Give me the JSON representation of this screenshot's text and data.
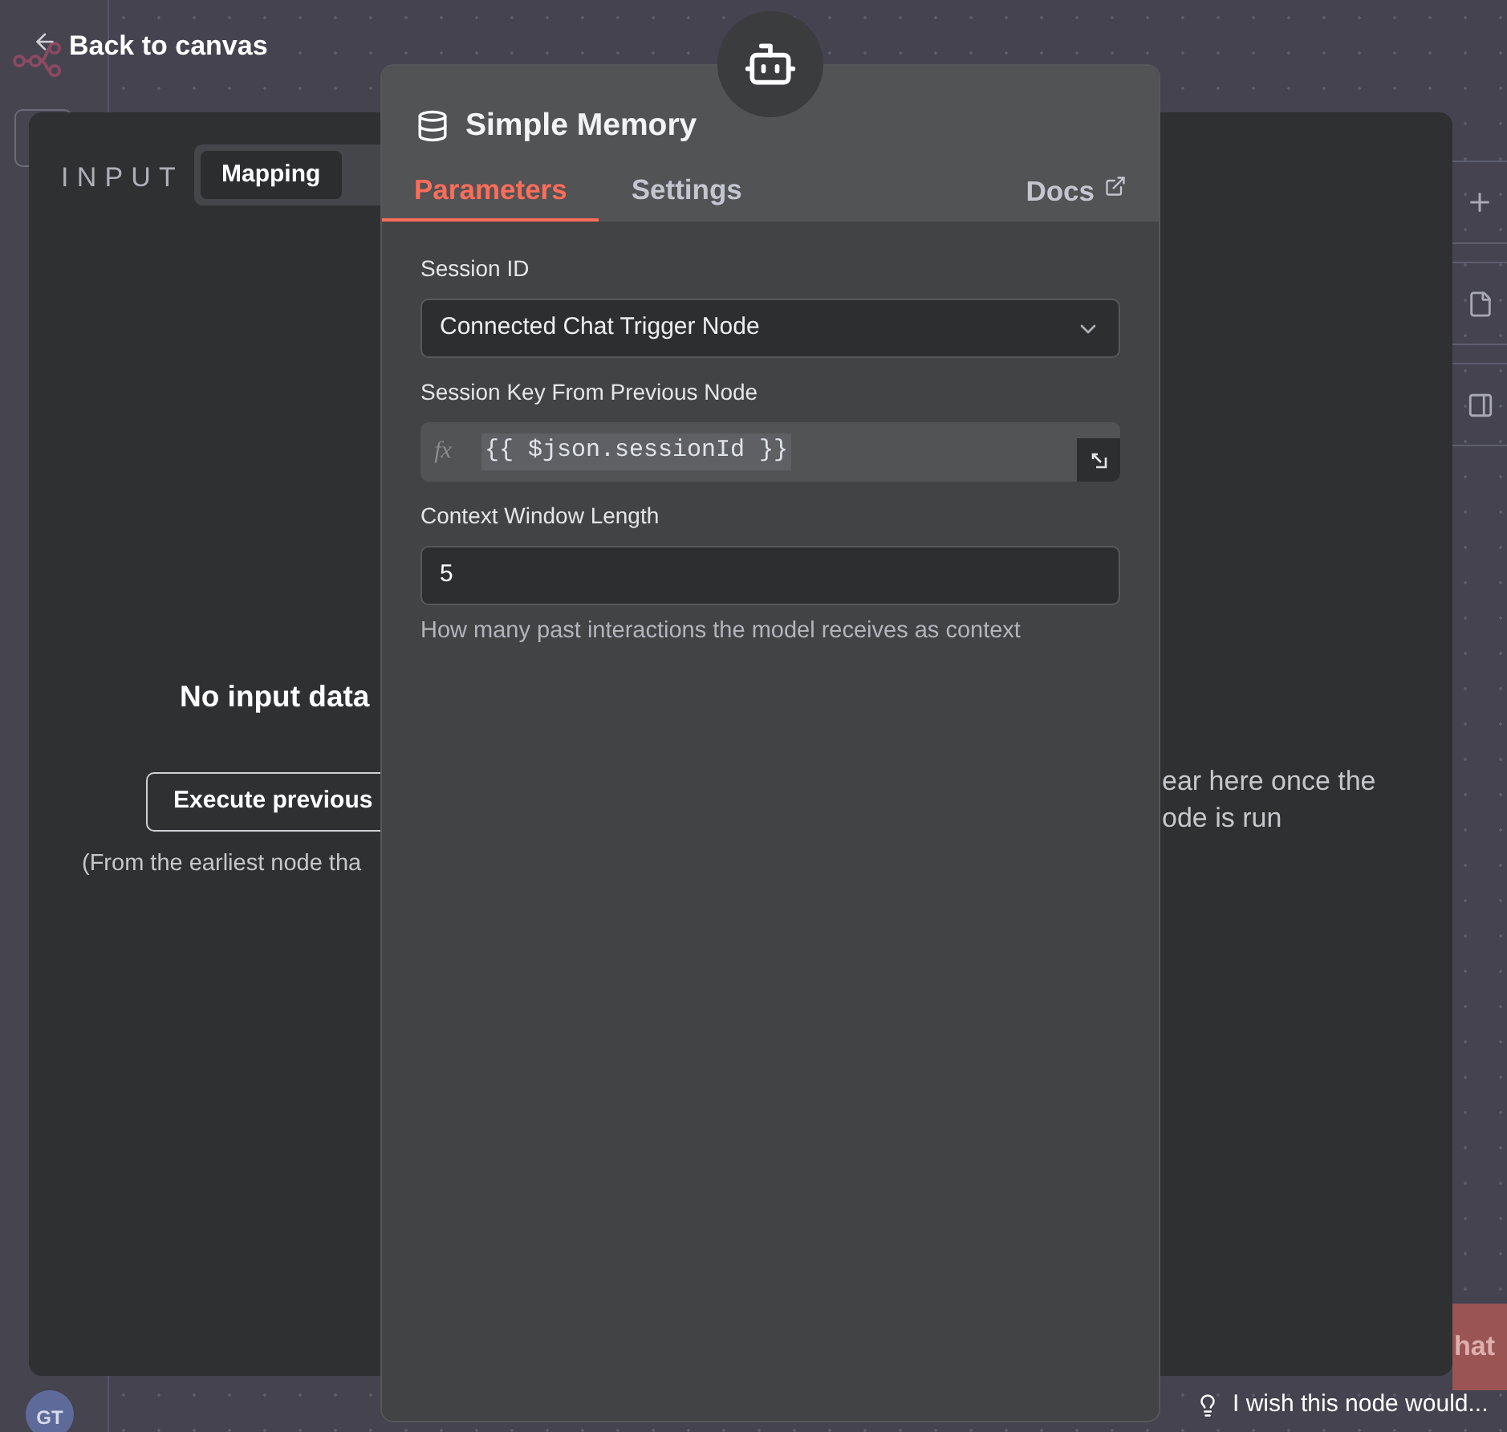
{
  "header": {
    "back_label": "Back to canvas"
  },
  "input_panel": {
    "title": "INPUT",
    "tabs": [
      {
        "label": "Mapping",
        "selected": true
      }
    ],
    "empty_title": "No input data",
    "execute_button": "Execute previous",
    "hint": "(From the earliest node tha"
  },
  "output_panel": {
    "lines": [
      "ear here once the",
      "ode is run"
    ]
  },
  "node": {
    "title": "Simple Memory",
    "tabs": [
      {
        "label": "Parameters",
        "selected": true
      },
      {
        "label": "Settings",
        "selected": false
      }
    ],
    "docs_link": "Docs",
    "parameters": [
      {
        "kind": "select",
        "label": "Session ID",
        "value": "Connected Chat Trigger Node"
      },
      {
        "kind": "expression",
        "label": "Session Key From Previous Node",
        "prefix": "fx",
        "value": "{{ $json.sessionId }}"
      },
      {
        "kind": "number",
        "label": "Context Window Length",
        "value": "5",
        "hint": "How many past interactions the model receives as context"
      }
    ]
  },
  "chat_button": "hat",
  "feedback": "I wish this node would...",
  "avatar": "GT"
}
